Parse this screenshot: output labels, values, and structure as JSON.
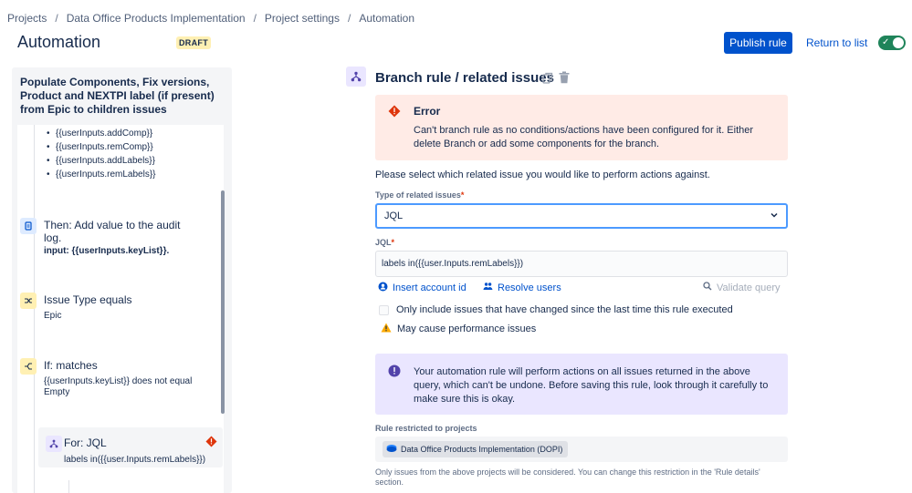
{
  "breadcrumb": {
    "items": [
      "Projects",
      "Data Office Products Implementation",
      "Project settings",
      "Automation"
    ],
    "separator": "/"
  },
  "header": {
    "title": "Automation",
    "badge": "DRAFT",
    "publish_label": "Publish rule",
    "return_label": "Return to list",
    "toggle_on": true
  },
  "left_panel": {
    "rule_name": "Populate Components, Fix versions, Product and NEXTPI label (if present) from Epic to children issues",
    "bullets": [
      "{{userInputs.addComp}}",
      "{{userInputs.remComp}}",
      "{{userInputs.addLabels}}",
      "{{userInputs.remLabels}}"
    ],
    "nodes": [
      {
        "title": "Then: Add value to the audit log.",
        "sub": "input: {{userInputs.keyList}}.",
        "icon": "document-icon"
      },
      {
        "title": "Issue Type equals",
        "sub": "Epic",
        "icon": "shuffle-icon"
      },
      {
        "title": "If: matches",
        "sub": "{{userInputs.keyList}} does not equal Empty",
        "icon": "branch-condition-icon"
      }
    ],
    "for_card": {
      "title": "For: JQL",
      "sub": "labels in({{user.Inputs.remLabels}})",
      "icon": "branch-icon",
      "status": "error-icon"
    }
  },
  "main": {
    "title": "Branch rule / related issues",
    "error": {
      "title": "Error",
      "text": "Can't branch rule as no conditions/actions have been configured for it. Either delete Branch or add some components for the branch."
    },
    "select_prompt": "Please select which related issue you would like to perform actions against.",
    "type_label": "Type of related issues",
    "type_value": "JQL",
    "jql_label": "JQL",
    "required_mark": "*",
    "jql_value": "labels in({{user.Inputs.remLabels}})",
    "insert_account_label": "Insert account id",
    "resolve_users_label": "Resolve users",
    "validate_label": "Validate query",
    "checkbox_label": "Only include issues that have changed since the last time this rule executed",
    "warning_text": "May cause performance issues",
    "info_text": "Your automation rule will perform actions on all issues returned in the above query, which can't be undone. Before saving this rule, look through it carefully to make sure this is okay.",
    "restricted_label": "Rule restricted to projects",
    "project_chip": "Data Office Products Implementation (DOPI)",
    "restricted_note": "Only issues from the above projects will be considered. You can change this restriction in the 'Rule details' section."
  },
  "colors": {
    "primary": "#0052cc",
    "toggle": "#1f845a",
    "error_bg": "#ffebe6",
    "error_icon": "#de350b",
    "info_bg": "#eae6ff",
    "info_icon": "#5243aa",
    "warning": "#ffab00",
    "draft_bg": "#fff0b3"
  }
}
